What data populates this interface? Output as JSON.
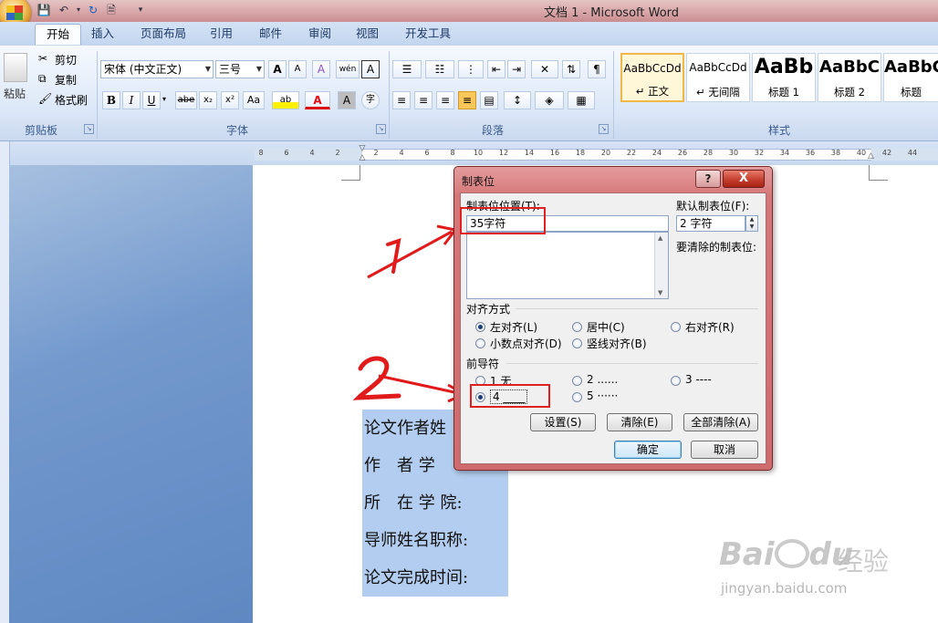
{
  "window": {
    "title": "文档 1 - Microsoft Word"
  },
  "tabs": [
    "开始",
    "插入",
    "页面布局",
    "引用",
    "邮件",
    "审阅",
    "视图",
    "开发工具"
  ],
  "active_tab": "开始",
  "ribbon": {
    "clipboard": {
      "paste": "粘贴",
      "cut": "剪切",
      "copy": "复制",
      "format_painter": "格式刷",
      "label": "剪贴板"
    },
    "font": {
      "font_name": "宋体 (中文正文)",
      "font_size": "三号",
      "label": "字体",
      "bold": "B",
      "italic": "I",
      "underline": "U",
      "strike": "abe",
      "sub": "x₂",
      "sup": "x²",
      "case": "Aa",
      "grow": "A",
      "shrink": "A",
      "clear": "A",
      "phonetic": "wén",
      "border_char": "A",
      "highlight": "ab",
      "color": "A",
      "shade": "A",
      "enclose": "字"
    },
    "paragraph": {
      "label": "段落"
    },
    "styles": {
      "label": "样式",
      "items": [
        {
          "sample": "AaBbCcDd",
          "name": "↵ 正文"
        },
        {
          "sample": "AaBbCcDd",
          "name": "↵ 无间隔"
        },
        {
          "sample": "AaBb",
          "name": "标题 1"
        },
        {
          "sample": "AaBbC",
          "name": "标题 2"
        },
        {
          "sample": "AaBbC",
          "name": "标题"
        }
      ]
    }
  },
  "ruler": {
    "numbers": [
      "8",
      "6",
      "4",
      "2",
      "2",
      "4",
      "6",
      "8",
      "10",
      "12",
      "14",
      "16",
      "18",
      "20",
      "22",
      "24",
      "26",
      "28",
      "30",
      "32",
      "34",
      "36",
      "38",
      "40",
      "42",
      "44"
    ]
  },
  "document": {
    "lines": [
      "论文作者姓",
      "作　者 学",
      "所　在 学 院:",
      "导师姓名职称:",
      "论文完成时间:"
    ]
  },
  "dialog": {
    "title": "制表位",
    "help": "?",
    "close": "X",
    "tab_stop_position_label": "制表位位置(T):",
    "tab_stop_position_value": "35字符",
    "default_tab_label": "默认制表位(F):",
    "default_tab_value": "2 字符",
    "to_clear_label": "要清除的制表位:",
    "alignment_label": "对齐方式",
    "alignment_options": [
      "左对齐(L)",
      "居中(C)",
      "右对齐(R)",
      "小数点对齐(D)",
      "竖线对齐(B)"
    ],
    "leader_label": "前导符",
    "leader_options": [
      "1 无",
      "2 ......",
      "3 ----",
      "4 ____",
      "5 ······"
    ],
    "buttons": {
      "set": "设置(S)",
      "clear": "清除(E)",
      "clear_all": "全部清除(A)",
      "ok": "确定",
      "cancel": "取消"
    }
  },
  "annotations": {
    "mark1": "1",
    "mark2": "2"
  },
  "watermark": {
    "brand": "Bai",
    "brand2": "du",
    "jingyan": "经验",
    "url": "jingyan.baidu.com"
  }
}
